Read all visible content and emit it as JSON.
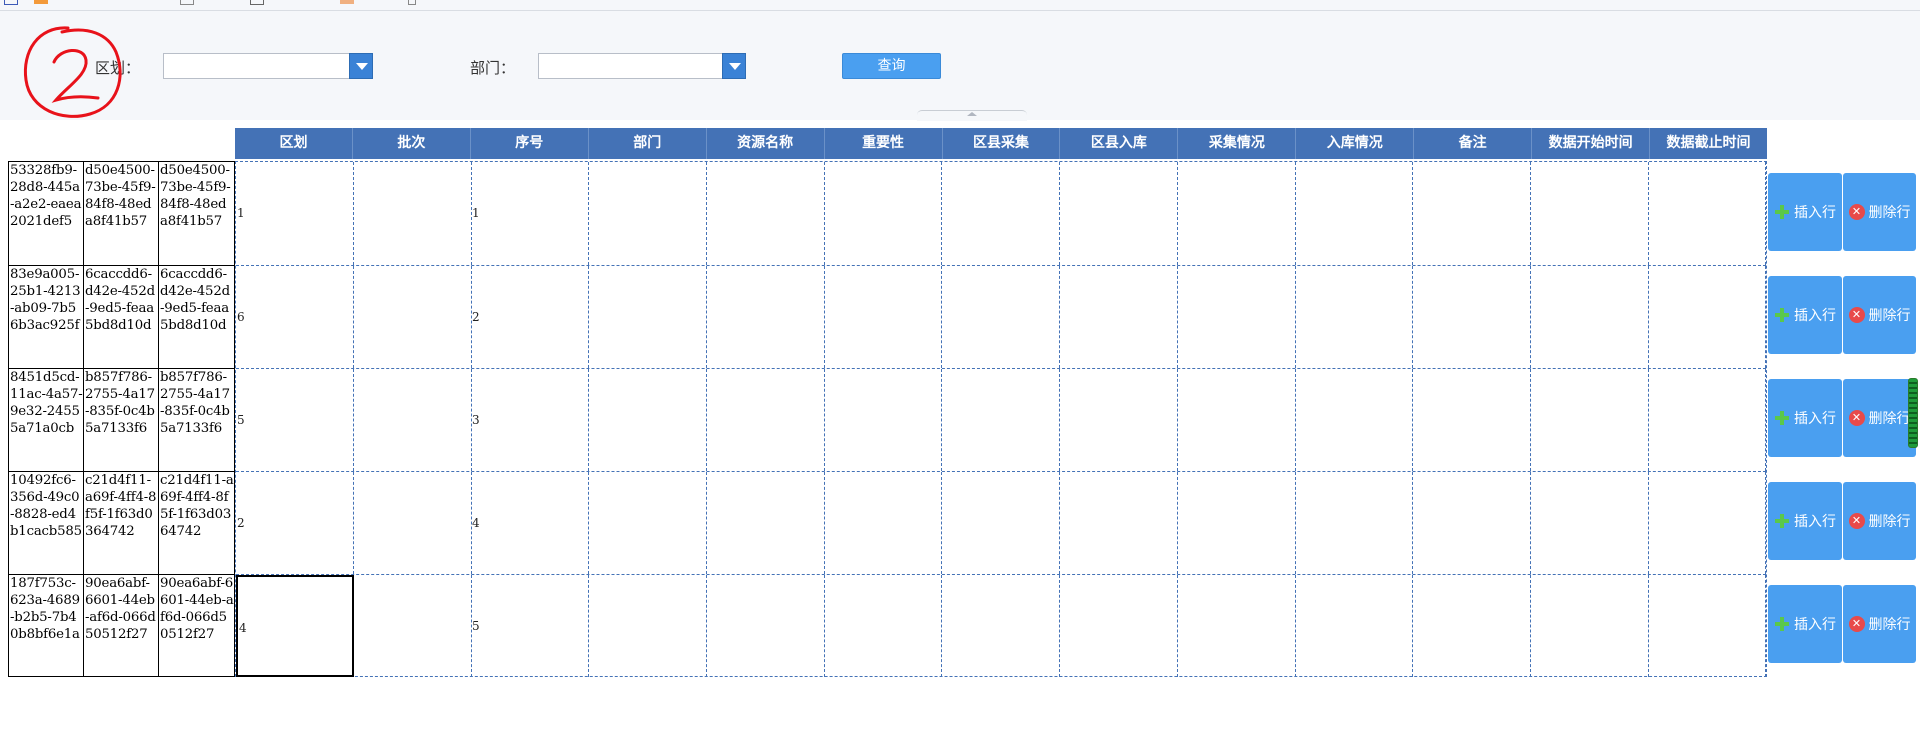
{
  "filter": {
    "district_label": "区划：",
    "dept_label": "部门：",
    "district_value": "",
    "dept_value": "",
    "query_label": "查询"
  },
  "headers": [
    "区划",
    "批次",
    "序号",
    "部门",
    "资源名称",
    "重要性",
    "区县采集",
    "区县入库",
    "采集情况",
    "入库情况",
    "备注",
    "数据开始时间",
    "数据截止时间"
  ],
  "rows": [
    {
      "id1": "53328fb9-28d8-445a-a2e2-eaea2021def5",
      "id2": "d50e4500-73be-45f9-84f8-48eda8f41b57",
      "id3": "d50e4500-73be-45f9-84f8-48eda8f41b57",
      "district": "1",
      "seq": "1"
    },
    {
      "id1": "83e9a005-25b1-4213-ab09-7b56b3ac925f",
      "id2": "6caccdd6-d42e-452d-9ed5-feaa5bd8d10d",
      "id3": "6caccdd6-d42e-452d-9ed5-feaa5bd8d10d",
      "district": "6",
      "seq": "2"
    },
    {
      "id1": "8451d5cd-11ac-4a57-9e32-24555a71a0cb",
      "id2": "b857f786-2755-4a17-835f-0c4b5a7133f6",
      "id3": "b857f786-2755-4a17-835f-0c4b5a7133f6",
      "district": "5",
      "seq": "3"
    },
    {
      "id1": "10492fc6-356d-49c0-8828-ed4b1cacb585",
      "id2": "c21d4f11-a69f-4ff4-8f5f-1f63d0364742",
      "id3": "c21d4f11-a69f-4ff4-8f5f-1f63d0364742",
      "district": "2",
      "seq": "4"
    },
    {
      "id1": "187f753c-623a-4689-b2b5-7b40b8bf6e1a",
      "id2": "90ea6abf-6601-44eb-af6d-066d50512f27",
      "id3": "90ea6abf-6601-44eb-af6d-066d50512f27",
      "district": "4",
      "seq": "5"
    }
  ],
  "actions": {
    "insert_label": "插入行",
    "delete_label": "删除行"
  },
  "icons": {
    "insert": "plus-icon",
    "delete": "close-circle-icon",
    "annotation": "circled-number-icon"
  },
  "colors": {
    "header": "#4472b6",
    "button": "#4a9ff0",
    "insert_icon": "#5ac84a",
    "delete_icon": "#e84a4a",
    "annotation": "#e8121a"
  }
}
